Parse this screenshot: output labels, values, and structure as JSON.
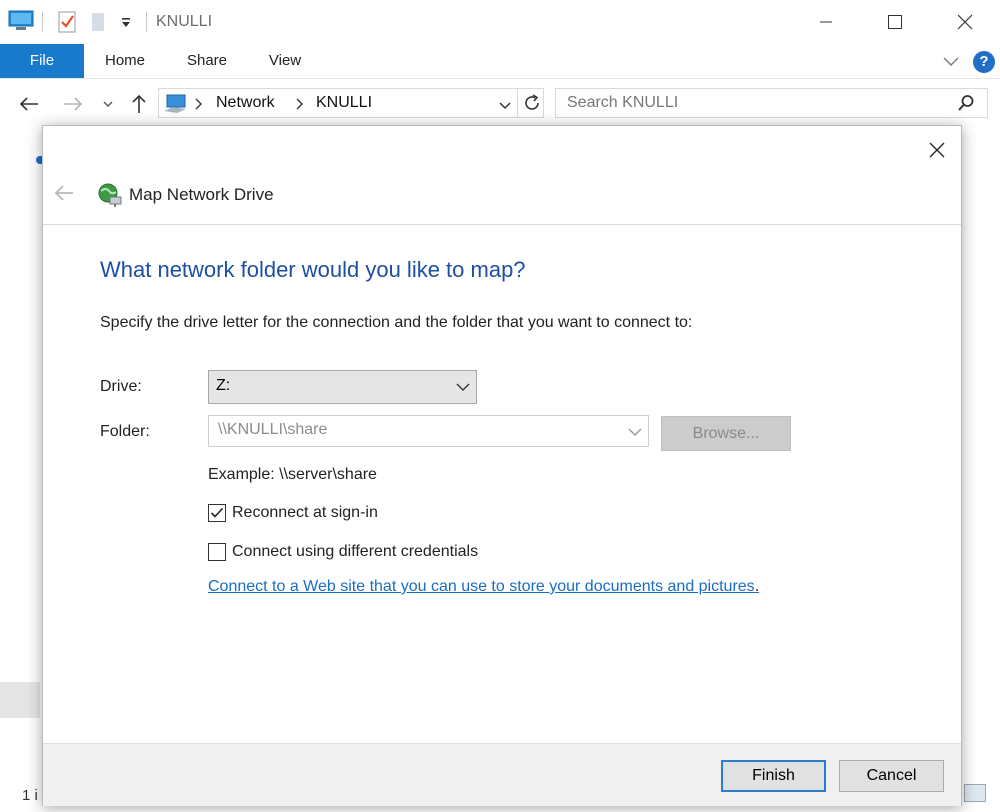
{
  "window": {
    "title": "KNULLI"
  },
  "ribbon": {
    "tabs": [
      "File",
      "Home",
      "Share",
      "View"
    ],
    "help": "?"
  },
  "address": {
    "crumbs": [
      "Network",
      "KNULLI"
    ]
  },
  "search": {
    "placeholder": "Search KNULLI"
  },
  "background": {
    "status_fragment": "1 i"
  },
  "dialog": {
    "title": "Map Network Drive",
    "heading": "What network folder would you like to map?",
    "instruction": "Specify the drive letter for the connection and the folder that you want to connect to:",
    "drive_label": "Drive:",
    "drive_value": "Z:",
    "folder_label": "Folder:",
    "folder_value": "\\\\KNULLI\\share",
    "browse_label": "Browse...",
    "example": "Example: \\\\server\\share",
    "reconnect_label": "Reconnect at sign-in",
    "reconnect_checked": true,
    "credentials_label": "Connect using different credentials",
    "credentials_checked": false,
    "link_text": "Connect to a Web site that you can use to store your documents and pictures",
    "link_suffix": ".",
    "finish_label": "Finish",
    "cancel_label": "Cancel"
  },
  "colors": {
    "accent": "#1979ca",
    "heading": "#1d4fa3",
    "link": "#1a6dc4"
  }
}
